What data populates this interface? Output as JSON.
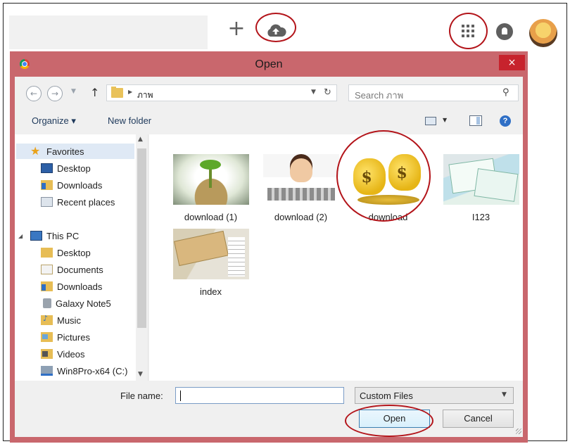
{
  "dialog": {
    "title": "Open",
    "close_glyph": "×"
  },
  "topbar": {
    "plus_glyph": "+"
  },
  "navbar": {
    "back_glyph": "←",
    "forward_glyph": "→",
    "up_glyph": "↑",
    "breadcrumb": "ภาพ",
    "refresh_glyph": "↻",
    "search_placeholder": "Search ภาพ",
    "search_glyph": "⚲"
  },
  "toolbar": {
    "organize_label": "Organize ▾",
    "new_folder_label": "New folder",
    "help_glyph": "?"
  },
  "navpane": {
    "favorites_label": "Favorites",
    "favorites": [
      {
        "label": "Desktop",
        "icon": "desktop-icon"
      },
      {
        "label": "Downloads",
        "icon": "downloads-folder-icon"
      },
      {
        "label": "Recent places",
        "icon": "recent-places-icon"
      }
    ],
    "this_pc_label": "This PC",
    "this_pc": [
      {
        "label": "Desktop",
        "icon": "desktop-folder-icon"
      },
      {
        "label": "Documents",
        "icon": "documents-folder-icon"
      },
      {
        "label": "Downloads",
        "icon": "downloads-folder-icon"
      },
      {
        "label": "Galaxy Note5",
        "icon": "phone-icon"
      },
      {
        "label": "Music",
        "icon": "music-folder-icon"
      },
      {
        "label": "Pictures",
        "icon": "pictures-folder-icon"
      },
      {
        "label": "Videos",
        "icon": "videos-folder-icon"
      },
      {
        "label": "Win8Pro-x64 (C:)",
        "icon": "drive-icon"
      }
    ]
  },
  "files": [
    {
      "name": "download (1)"
    },
    {
      "name": "download (2)"
    },
    {
      "name": "download"
    },
    {
      "name": "I123"
    },
    {
      "name": "index"
    }
  ],
  "bottom": {
    "file_name_label": "File name:",
    "file_name_value": "",
    "file_type_selected": "Custom Files",
    "open_label": "Open",
    "cancel_label": "Cancel"
  },
  "colors": {
    "dialog_frame": "#c9676d",
    "close_button": "#c7232d",
    "highlight_ring": "#b3141a"
  }
}
